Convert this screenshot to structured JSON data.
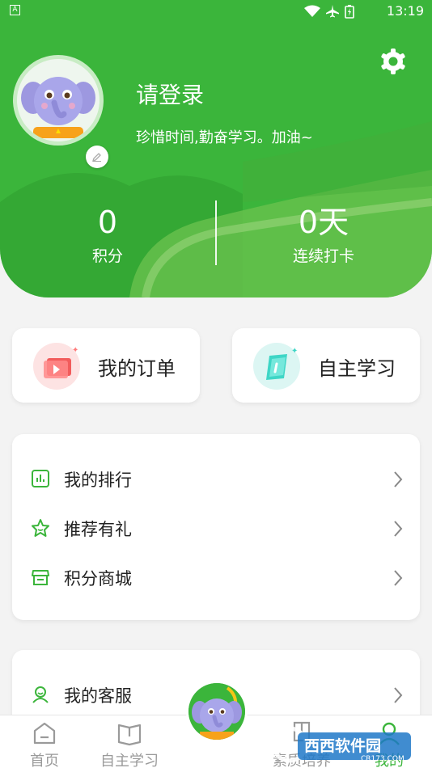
{
  "status_bar": {
    "time": "13:19",
    "notification_icon": "a-icon"
  },
  "profile": {
    "login_title": "请登录",
    "motto": "珍惜时间,勤奋学习。加油~"
  },
  "stats": {
    "points_value": "0",
    "points_label": "积分",
    "streak_value": "0天",
    "streak_label": "连续打卡"
  },
  "quick_actions": [
    {
      "label": "我的订单",
      "icon": "video-icon"
    },
    {
      "label": "自主学习",
      "icon": "book-icon"
    }
  ],
  "menu_group_1": [
    {
      "label": "我的排行",
      "icon": "chart-icon"
    },
    {
      "label": "推荐有礼",
      "icon": "star-icon"
    },
    {
      "label": "积分商城",
      "icon": "store-icon"
    }
  ],
  "menu_group_2": [
    {
      "label": "我的客服",
      "icon": "support-icon"
    }
  ],
  "tabs": [
    {
      "label": "首页",
      "icon": "home-icon"
    },
    {
      "label": "自主学习",
      "icon": "book-icon"
    },
    {
      "label": "素质培养",
      "icon": "quality-icon"
    },
    {
      "label": "我的",
      "icon": "user-icon",
      "active": true
    }
  ],
  "watermark": {
    "text": "西西软件园",
    "sub": "CR173.COM"
  },
  "colors": {
    "primary": "#3bb53b",
    "background": "#f3f3f3",
    "card": "#ffffff"
  }
}
